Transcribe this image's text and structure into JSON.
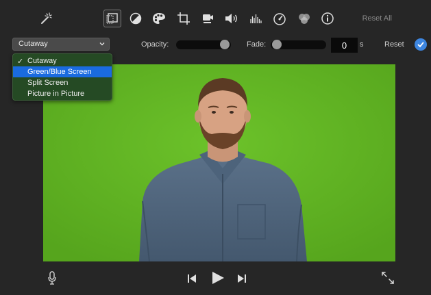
{
  "toolbar": {
    "icons": [
      "magic-wand-icon",
      "video-overlay-icon",
      "color-balance-icon",
      "color-palette-icon",
      "crop-icon",
      "stabilization-icon",
      "volume-icon",
      "equalizer-icon",
      "speed-icon",
      "filter-icon",
      "info-icon"
    ],
    "active_tool": "video-overlay-icon",
    "reset_all_label": "Reset All"
  },
  "overlay_controls": {
    "style_select": {
      "selected": "Cutaway"
    },
    "opacity_label": "Opacity:",
    "opacity_value": 1.0,
    "fade_label": "Fade:",
    "fade_value": "0",
    "fade_unit": "s",
    "reset_label": "Reset",
    "apply_icon": "checkmark-icon"
  },
  "style_dropdown": {
    "items": [
      {
        "label": "Cutaway",
        "checked": true,
        "highlighted": false
      },
      {
        "label": "Green/Blue Screen",
        "checked": false,
        "highlighted": true
      },
      {
        "label": "Split Screen",
        "checked": false,
        "highlighted": false
      },
      {
        "label": "Picture in Picture",
        "checked": false,
        "highlighted": false
      }
    ],
    "check_mark": "✓"
  },
  "viewer": {
    "background_color": "#60b322"
  },
  "playback": {
    "icons": [
      "microphone-icon",
      "skip-back-icon",
      "play-icon",
      "skip-forward-icon",
      "fullscreen-icon"
    ]
  },
  "colors": {
    "accent": "#3d86e0",
    "highlight": "#1a6be0",
    "background": "#262626"
  }
}
